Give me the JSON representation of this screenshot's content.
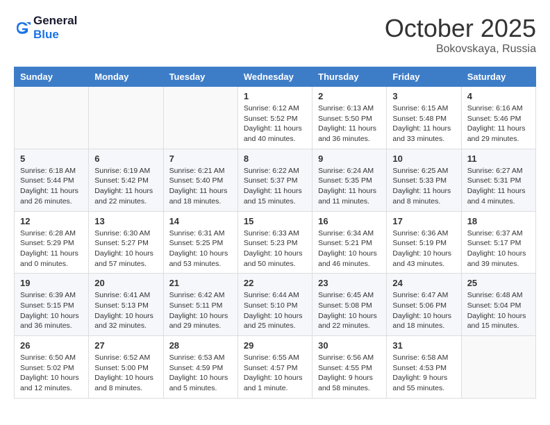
{
  "header": {
    "logo_line1": "General",
    "logo_line2": "Blue",
    "month": "October 2025",
    "location": "Bokovskaya, Russia"
  },
  "weekdays": [
    "Sunday",
    "Monday",
    "Tuesday",
    "Wednesday",
    "Thursday",
    "Friday",
    "Saturday"
  ],
  "weeks": [
    [
      {
        "day": "",
        "sunrise": "",
        "sunset": "",
        "daylight": ""
      },
      {
        "day": "",
        "sunrise": "",
        "sunset": "",
        "daylight": ""
      },
      {
        "day": "",
        "sunrise": "",
        "sunset": "",
        "daylight": ""
      },
      {
        "day": "1",
        "sunrise": "Sunrise: 6:12 AM",
        "sunset": "Sunset: 5:52 PM",
        "daylight": "Daylight: 11 hours and 40 minutes."
      },
      {
        "day": "2",
        "sunrise": "Sunrise: 6:13 AM",
        "sunset": "Sunset: 5:50 PM",
        "daylight": "Daylight: 11 hours and 36 minutes."
      },
      {
        "day": "3",
        "sunrise": "Sunrise: 6:15 AM",
        "sunset": "Sunset: 5:48 PM",
        "daylight": "Daylight: 11 hours and 33 minutes."
      },
      {
        "day": "4",
        "sunrise": "Sunrise: 6:16 AM",
        "sunset": "Sunset: 5:46 PM",
        "daylight": "Daylight: 11 hours and 29 minutes."
      }
    ],
    [
      {
        "day": "5",
        "sunrise": "Sunrise: 6:18 AM",
        "sunset": "Sunset: 5:44 PM",
        "daylight": "Daylight: 11 hours and 26 minutes."
      },
      {
        "day": "6",
        "sunrise": "Sunrise: 6:19 AM",
        "sunset": "Sunset: 5:42 PM",
        "daylight": "Daylight: 11 hours and 22 minutes."
      },
      {
        "day": "7",
        "sunrise": "Sunrise: 6:21 AM",
        "sunset": "Sunset: 5:40 PM",
        "daylight": "Daylight: 11 hours and 18 minutes."
      },
      {
        "day": "8",
        "sunrise": "Sunrise: 6:22 AM",
        "sunset": "Sunset: 5:37 PM",
        "daylight": "Daylight: 11 hours and 15 minutes."
      },
      {
        "day": "9",
        "sunrise": "Sunrise: 6:24 AM",
        "sunset": "Sunset: 5:35 PM",
        "daylight": "Daylight: 11 hours and 11 minutes."
      },
      {
        "day": "10",
        "sunrise": "Sunrise: 6:25 AM",
        "sunset": "Sunset: 5:33 PM",
        "daylight": "Daylight: 11 hours and 8 minutes."
      },
      {
        "day": "11",
        "sunrise": "Sunrise: 6:27 AM",
        "sunset": "Sunset: 5:31 PM",
        "daylight": "Daylight: 11 hours and 4 minutes."
      }
    ],
    [
      {
        "day": "12",
        "sunrise": "Sunrise: 6:28 AM",
        "sunset": "Sunset: 5:29 PM",
        "daylight": "Daylight: 11 hours and 0 minutes."
      },
      {
        "day": "13",
        "sunrise": "Sunrise: 6:30 AM",
        "sunset": "Sunset: 5:27 PM",
        "daylight": "Daylight: 10 hours and 57 minutes."
      },
      {
        "day": "14",
        "sunrise": "Sunrise: 6:31 AM",
        "sunset": "Sunset: 5:25 PM",
        "daylight": "Daylight: 10 hours and 53 minutes."
      },
      {
        "day": "15",
        "sunrise": "Sunrise: 6:33 AM",
        "sunset": "Sunset: 5:23 PM",
        "daylight": "Daylight: 10 hours and 50 minutes."
      },
      {
        "day": "16",
        "sunrise": "Sunrise: 6:34 AM",
        "sunset": "Sunset: 5:21 PM",
        "daylight": "Daylight: 10 hours and 46 minutes."
      },
      {
        "day": "17",
        "sunrise": "Sunrise: 6:36 AM",
        "sunset": "Sunset: 5:19 PM",
        "daylight": "Daylight: 10 hours and 43 minutes."
      },
      {
        "day": "18",
        "sunrise": "Sunrise: 6:37 AM",
        "sunset": "Sunset: 5:17 PM",
        "daylight": "Daylight: 10 hours and 39 minutes."
      }
    ],
    [
      {
        "day": "19",
        "sunrise": "Sunrise: 6:39 AM",
        "sunset": "Sunset: 5:15 PM",
        "daylight": "Daylight: 10 hours and 36 minutes."
      },
      {
        "day": "20",
        "sunrise": "Sunrise: 6:41 AM",
        "sunset": "Sunset: 5:13 PM",
        "daylight": "Daylight: 10 hours and 32 minutes."
      },
      {
        "day": "21",
        "sunrise": "Sunrise: 6:42 AM",
        "sunset": "Sunset: 5:11 PM",
        "daylight": "Daylight: 10 hours and 29 minutes."
      },
      {
        "day": "22",
        "sunrise": "Sunrise: 6:44 AM",
        "sunset": "Sunset: 5:10 PM",
        "daylight": "Daylight: 10 hours and 25 minutes."
      },
      {
        "day": "23",
        "sunrise": "Sunrise: 6:45 AM",
        "sunset": "Sunset: 5:08 PM",
        "daylight": "Daylight: 10 hours and 22 minutes."
      },
      {
        "day": "24",
        "sunrise": "Sunrise: 6:47 AM",
        "sunset": "Sunset: 5:06 PM",
        "daylight": "Daylight: 10 hours and 18 minutes."
      },
      {
        "day": "25",
        "sunrise": "Sunrise: 6:48 AM",
        "sunset": "Sunset: 5:04 PM",
        "daylight": "Daylight: 10 hours and 15 minutes."
      }
    ],
    [
      {
        "day": "26",
        "sunrise": "Sunrise: 6:50 AM",
        "sunset": "Sunset: 5:02 PM",
        "daylight": "Daylight: 10 hours and 12 minutes."
      },
      {
        "day": "27",
        "sunrise": "Sunrise: 6:52 AM",
        "sunset": "Sunset: 5:00 PM",
        "daylight": "Daylight: 10 hours and 8 minutes."
      },
      {
        "day": "28",
        "sunrise": "Sunrise: 6:53 AM",
        "sunset": "Sunset: 4:59 PM",
        "daylight": "Daylight: 10 hours and 5 minutes."
      },
      {
        "day": "29",
        "sunrise": "Sunrise: 6:55 AM",
        "sunset": "Sunset: 4:57 PM",
        "daylight": "Daylight: 10 hours and 1 minute."
      },
      {
        "day": "30",
        "sunrise": "Sunrise: 6:56 AM",
        "sunset": "Sunset: 4:55 PM",
        "daylight": "Daylight: 9 hours and 58 minutes."
      },
      {
        "day": "31",
        "sunrise": "Sunrise: 6:58 AM",
        "sunset": "Sunset: 4:53 PM",
        "daylight": "Daylight: 9 hours and 55 minutes."
      },
      {
        "day": "",
        "sunrise": "",
        "sunset": "",
        "daylight": ""
      }
    ]
  ]
}
